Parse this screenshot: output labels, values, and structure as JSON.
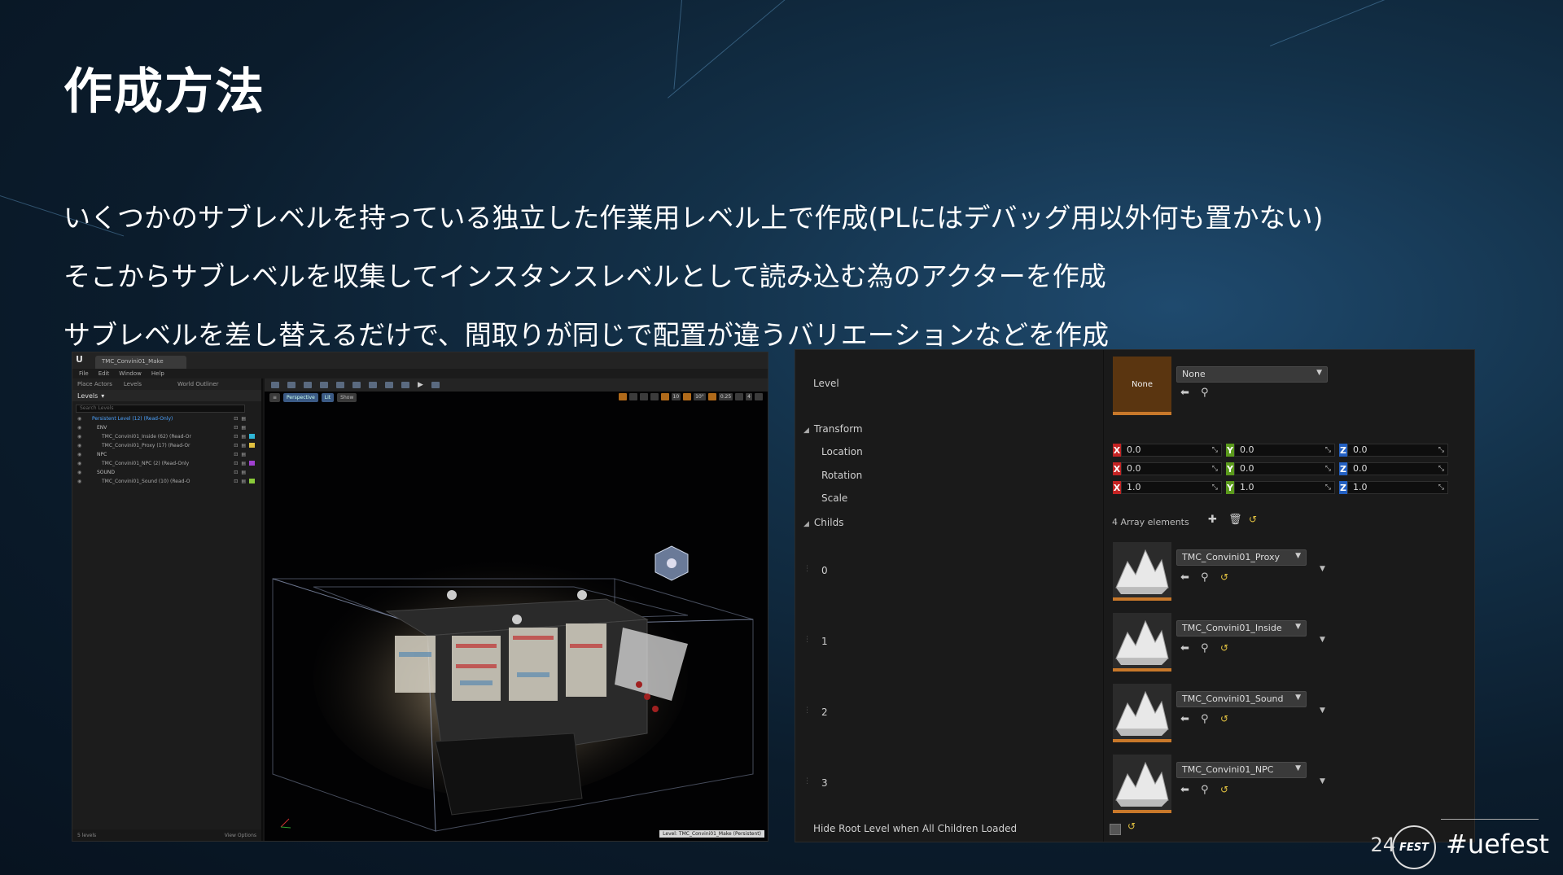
{
  "slide": {
    "title": "作成方法",
    "bullets": [
      "いくつかのサブレベルを持っている独立した作業用レベル上で作成(PLにはデバッグ用以外何も置かない)",
      "そこからサブレベルを収集してインスタンスレベルとして読み込む為のアクターを作成",
      "サブレベルを差し替えるだけで、間取りが同じで配置が違うバリエーションなどを作成"
    ],
    "page_number": "24",
    "hashtag": "#uefest",
    "logo_text": "FEST"
  },
  "editor": {
    "tab_title": "TMC_Convini01_Make",
    "menu": [
      "File",
      "Edit",
      "Window",
      "Help"
    ],
    "left_tabs": [
      "Place Actors",
      "Levels",
      "World Outliner"
    ],
    "levels_header": "Levels",
    "search_placeholder": "Search Levels",
    "levels": [
      {
        "name": "Persistent Level (12) (Read-Only)",
        "indent": 1,
        "color": "#4da3ff",
        "swatch": ""
      },
      {
        "name": "ENV",
        "indent": 2,
        "color": "#bbbbbb",
        "swatch": ""
      },
      {
        "name": "TMC_Convini01_Inside (62) (Read-Or",
        "indent": 3,
        "color": "#aaaaaa",
        "swatch": "#2fb6d6"
      },
      {
        "name": "TMC_Convini01_Proxy (17) (Read-Or",
        "indent": 3,
        "color": "#aaaaaa",
        "swatch": "#e0c040"
      },
      {
        "name": "NPC",
        "indent": 2,
        "color": "#bbbbbb",
        "swatch": ""
      },
      {
        "name": "TMC_Convini01_NPC (2) (Read-Only",
        "indent": 3,
        "color": "#aaaaaa",
        "swatch": "#a040d0"
      },
      {
        "name": "SOUND",
        "indent": 2,
        "color": "#bbbbbb",
        "swatch": ""
      },
      {
        "name": "TMC_Convini01_Sound (10) (Read-O",
        "indent": 3,
        "color": "#aaaaaa",
        "swatch": "#8acb3a"
      }
    ],
    "footer_left": "5 levels",
    "footer_right": "View Options",
    "viewport_chips": [
      "Perspective",
      "Lit",
      "Show"
    ],
    "viewport_right": [
      "10",
      "10°",
      "0.25",
      "4"
    ],
    "status": "Level: TMC_Convini01_Make (Persistent)"
  },
  "details": {
    "level_label": "Level",
    "level_thumb": "None",
    "level_value": "None",
    "transform_label": "Transform",
    "location_label": "Location",
    "rotation_label": "Rotation",
    "scale_label": "Scale",
    "location": [
      "0.0",
      "0.0",
      "0.0"
    ],
    "rotation": [
      "0.0",
      "0.0",
      "0.0"
    ],
    "scale": [
      "1.0",
      "1.0",
      "1.0"
    ],
    "childs_label": "Childs",
    "array_count": "4 Array elements",
    "children": [
      {
        "index": "0",
        "value": "TMC_Convini01_Proxy"
      },
      {
        "index": "1",
        "value": "TMC_Convini01_Inside"
      },
      {
        "index": "2",
        "value": "TMC_Convini01_Sound"
      },
      {
        "index": "3",
        "value": "TMC_Convini01_NPC"
      }
    ],
    "hide_root_label": "Hide Root Level when All Children Loaded"
  }
}
